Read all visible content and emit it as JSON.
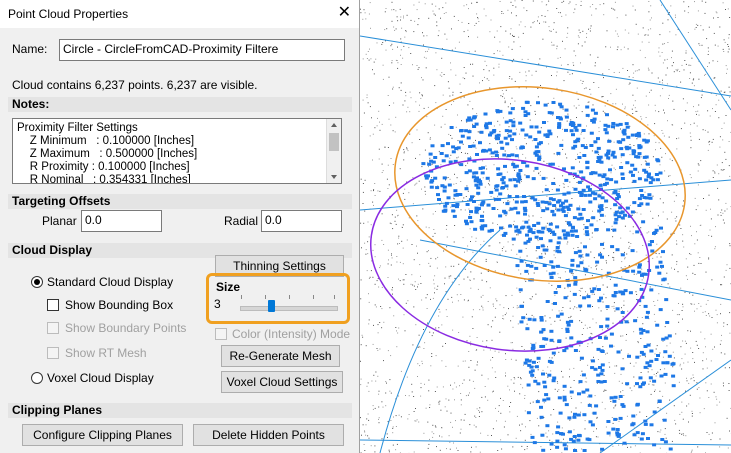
{
  "dialog": {
    "title": "Point Cloud Properties",
    "close_glyph": "✕",
    "name_label": "Name:",
    "name_value": "Circle - CircleFromCAD-Proximity Filtere",
    "cloud_summary": "Cloud contains 6,237 points.  6,237 are visible."
  },
  "notes": {
    "label": "Notes:",
    "lines": [
      "Proximity Filter Settings",
      "    Z Minimum   : 0.100000 [Inches]",
      "    Z Maximum   : 0.500000 [Inches]",
      "    R Proximity : 0.100000 [Inches]",
      "    R Nominal   : 0.354331 [Inches]"
    ]
  },
  "targeting": {
    "label": "Targeting Offsets",
    "planar_label": "Planar",
    "planar_value": "0.0",
    "radial_label": "Radial",
    "radial_value": "0.0"
  },
  "cloud_display": {
    "label": "Cloud Display",
    "thinning_button": "Thinning Settings",
    "standard_label": "Standard Cloud Display",
    "bounding_box_label": "Show Bounding Box",
    "boundary_points_label": "Show Boundary Points",
    "rt_mesh_label": "Show RT Mesh",
    "voxel_label": "Voxel Cloud Display",
    "size_label": "Size",
    "size_value": "3",
    "color_mode_label": "Color (Intensity) Mode",
    "regen_button": "Re-Generate Mesh",
    "voxel_button": "Voxel Cloud Settings"
  },
  "clipping": {
    "label": "Clipping Planes",
    "configure_button": "Configure Clipping Planes",
    "delete_button": "Delete Hidden Points"
  },
  "colors": {
    "highlight": "#f0a020",
    "point_blue": "#1e78e6",
    "ellipse_orange": "#e8962c",
    "ellipse_purple": "#8a2be2",
    "line_blue": "#2a8fd8"
  }
}
